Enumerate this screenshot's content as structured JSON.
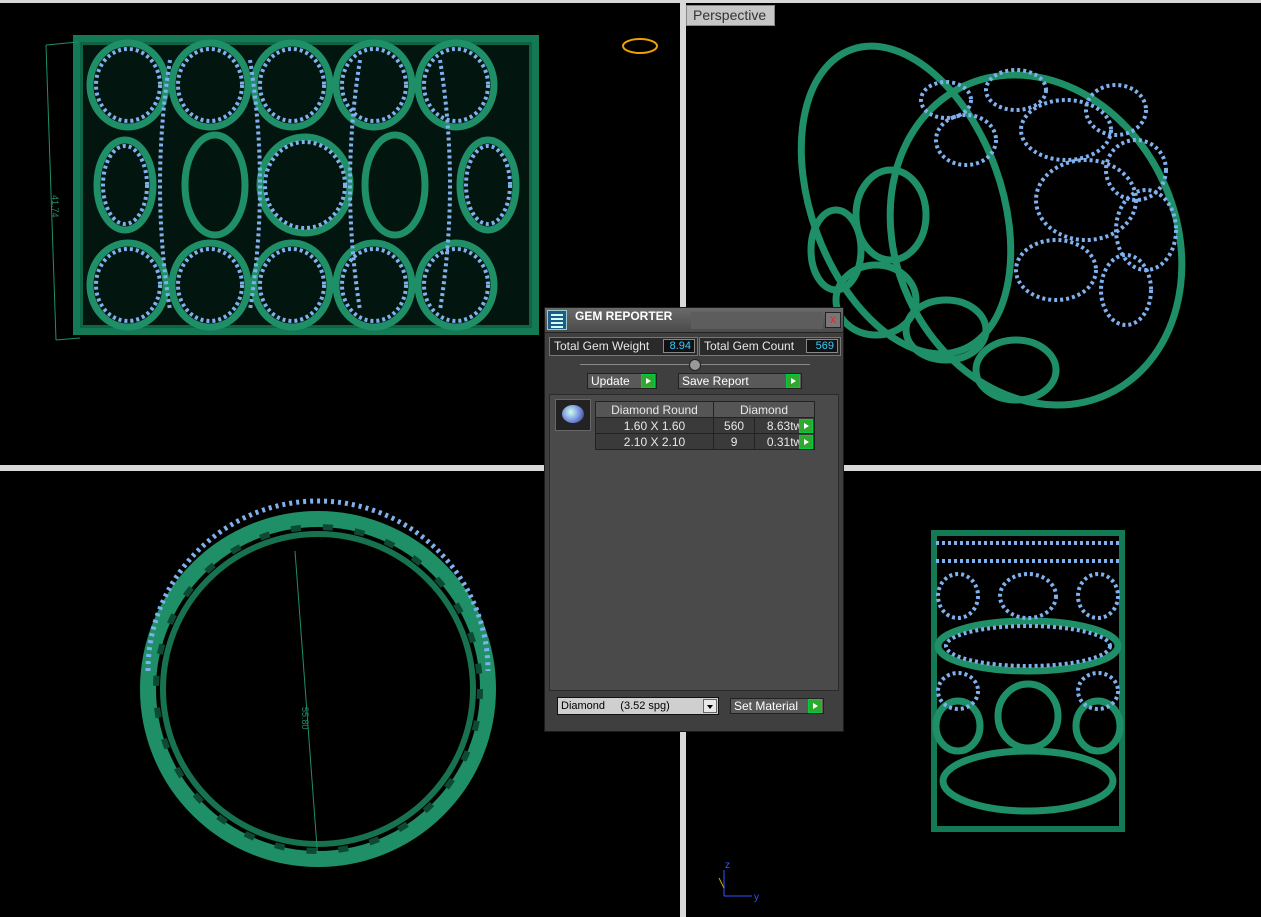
{
  "viewports": {
    "top_right_label": "Perspective"
  },
  "dimensions": {
    "height_annotation": "41.74",
    "diameter_annotation": "55.80"
  },
  "axes": {
    "vertical": "z",
    "horizontal": "y"
  },
  "gem_reporter": {
    "title": "GEM REPORTER",
    "close_symbol": "x",
    "total_weight_label": "Total Gem Weight",
    "total_weight_value": "8.94",
    "total_count_label": "Total Gem Count",
    "total_count_value": "569",
    "update_label": "Update",
    "save_report_label": "Save Report",
    "table": {
      "headers": [
        "Diamond Round",
        "Diamond"
      ],
      "rows": [
        {
          "size": "1.60 X 1.60",
          "count": "560",
          "weight": "8.63tw"
        },
        {
          "size": "2.10 X 2.10",
          "count": "9",
          "weight": "0.31tw"
        }
      ]
    },
    "material_select": "Diamond     (3.52 spg)",
    "set_material_label": "Set Material"
  },
  "colors": {
    "metal": "#1e8f66",
    "gem": "#7fb1ef",
    "accent_button": "#2fa82f",
    "value_text": "#33ccff"
  }
}
